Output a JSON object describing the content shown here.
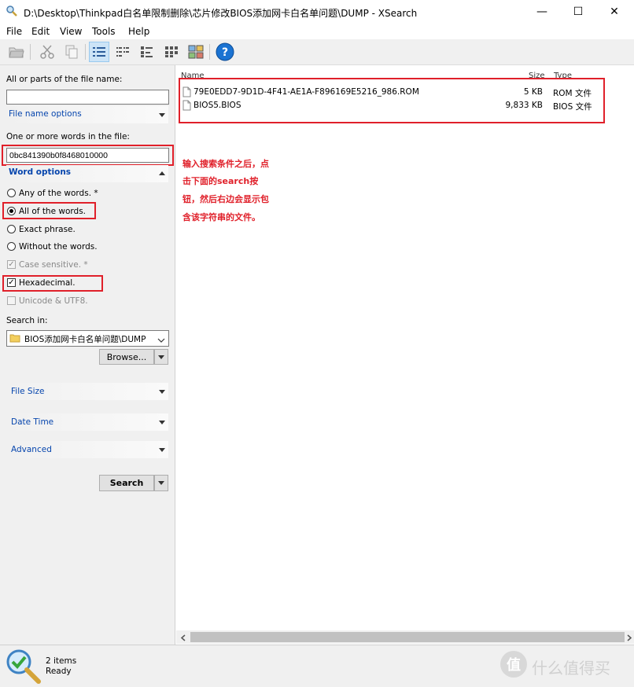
{
  "window": {
    "title": "D:\\Desktop\\Thinkpad白名单限制删除\\芯片修改BIOS添加网卡白名单问题\\DUMP - XSearch",
    "minimize": "—",
    "maximize": "☐",
    "close": "✕"
  },
  "menu": [
    "File",
    "Edit",
    "View",
    "Tools",
    "Help"
  ],
  "toolbar": {
    "icons": [
      "open-folder-icon",
      "cut-icon",
      "copy-icon",
      "details-view-icon",
      "list-view-icon",
      "small-icons-view-icon",
      "large-icons-view-icon",
      "thumbnails-view-icon",
      "help-icon"
    ],
    "help_glyph": "?"
  },
  "search": {
    "filename_label": "All or parts of the file name:",
    "filename_value": "",
    "filename_options": "File name options",
    "words_label": "One or more words in the file:",
    "words_value": "0bc841390b0f8468010000",
    "word_options": "Word options",
    "options": [
      {
        "label": "Any of the words. *",
        "selected": false
      },
      {
        "label": "All of the words.",
        "selected": true
      },
      {
        "label": "Exact phrase.",
        "selected": false
      },
      {
        "label": "Without the words.",
        "selected": false
      }
    ],
    "case_sensitive": "Case sensitive. *",
    "hexadecimal": "Hexadecimal.",
    "unicode": "Unicode & UTF8.",
    "search_in_label": "Search in:",
    "search_in_value": "BIOS添加网卡白名单问题\\DUMP",
    "browse": "Browse...",
    "file_size": "File Size",
    "date_time": "Date Time",
    "advanced": "Advanced",
    "search_button": "Search"
  },
  "annotation": {
    "lines": [
      "输入搜索条件之后，点",
      "击下面的search按",
      "钮，然后右边会显示包",
      "含该字符串的文件。"
    ]
  },
  "results": {
    "columns": {
      "name": "Name",
      "size": "Size",
      "type": "Type"
    },
    "rows": [
      {
        "name": "79E0EDD7-9D1D-4F41-AE1A-F896169E5216_986.ROM",
        "size": "5 KB",
        "type": "ROM 文件"
      },
      {
        "name": "BIOS5.BIOS",
        "size": "9,833 KB",
        "type": "BIOS 文件"
      }
    ]
  },
  "status": {
    "count": "2 items",
    "state": "Ready"
  },
  "watermark": "值 什么值得买",
  "colors": {
    "highlight": "#e0202a",
    "link": "#0645ad",
    "accent": "#1b73d2"
  }
}
